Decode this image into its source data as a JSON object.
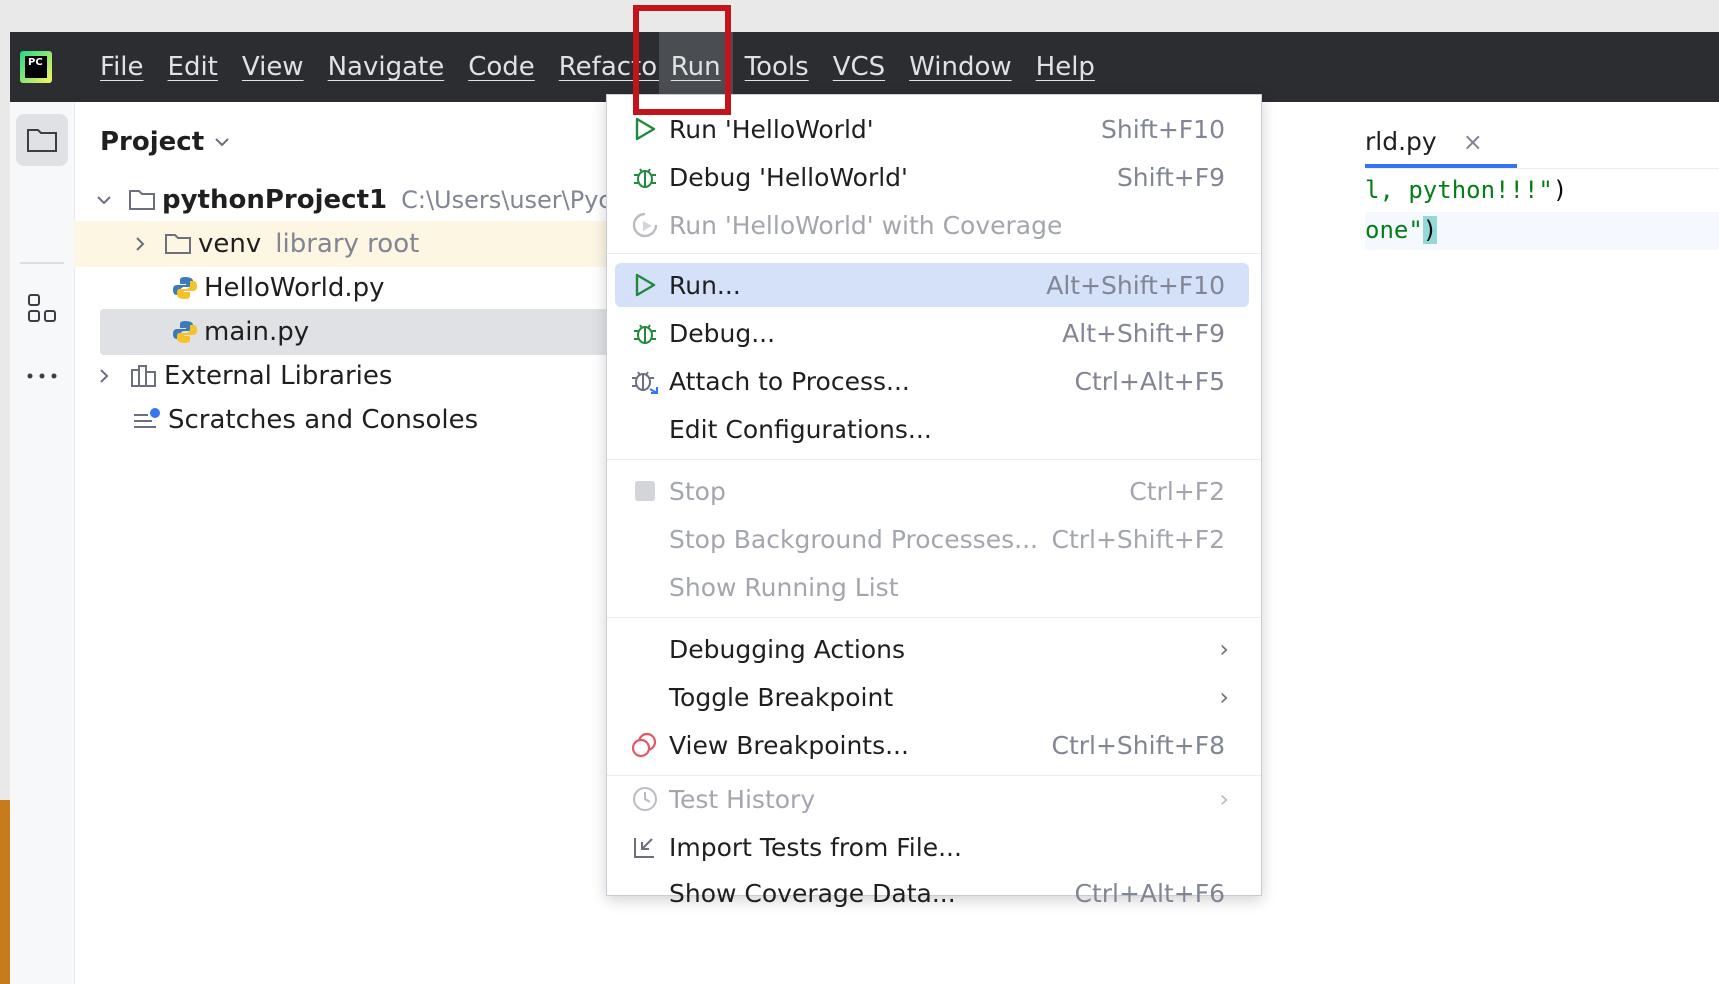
{
  "menubar": {
    "items": [
      "File",
      "Edit",
      "View",
      "Navigate",
      "Code",
      "Refactor",
      "Run",
      "Tools",
      "VCS",
      "Window",
      "Help"
    ],
    "active": "Run"
  },
  "project": {
    "header": "Project",
    "root_name": "pythonProject1",
    "root_path": "C:\\Users\\user\\Pycharm",
    "venv_name": "venv",
    "venv_hint": "library root",
    "file1": "HelloWorld.py",
    "file2": "main.py",
    "ext_libs": "External Libraries",
    "scratches": "Scratches and Consoles"
  },
  "editor": {
    "tab_label": "rld.py",
    "line1": "l, python!!!\"",
    "line2": "one\""
  },
  "dropdown": {
    "items": [
      {
        "label": "Run 'HelloWorld'",
        "shortcut": "Shift+F10"
      },
      {
        "label": "Debug 'HelloWorld'",
        "shortcut": "Shift+F9"
      },
      {
        "label": "Run 'HelloWorld' with Coverage",
        "shortcut": ""
      },
      {
        "label": "Run...",
        "shortcut": "Alt+Shift+F10"
      },
      {
        "label": "Debug...",
        "shortcut": "Alt+Shift+F9"
      },
      {
        "label": "Attach to Process...",
        "shortcut": "Ctrl+Alt+F5"
      },
      {
        "label": "Edit Configurations...",
        "shortcut": ""
      },
      {
        "label": "Stop",
        "shortcut": "Ctrl+F2"
      },
      {
        "label": "Stop Background Processes...",
        "shortcut": "Ctrl+Shift+F2"
      },
      {
        "label": "Show Running List",
        "shortcut": ""
      },
      {
        "label": "Debugging Actions",
        "shortcut": ""
      },
      {
        "label": "Toggle Breakpoint",
        "shortcut": ""
      },
      {
        "label": "View Breakpoints...",
        "shortcut": "Ctrl+Shift+F8"
      },
      {
        "label": "Test History",
        "shortcut": ""
      },
      {
        "label": "Import Tests from File...",
        "shortcut": ""
      },
      {
        "label": "Show Coverage Data...",
        "shortcut": "Ctrl+Alt+F6"
      }
    ]
  },
  "colors": {
    "accent": "#3574f0",
    "highlight_box": "#c2141a",
    "menubar_bg": "#2b2d30",
    "run_green": "#208a3c"
  }
}
